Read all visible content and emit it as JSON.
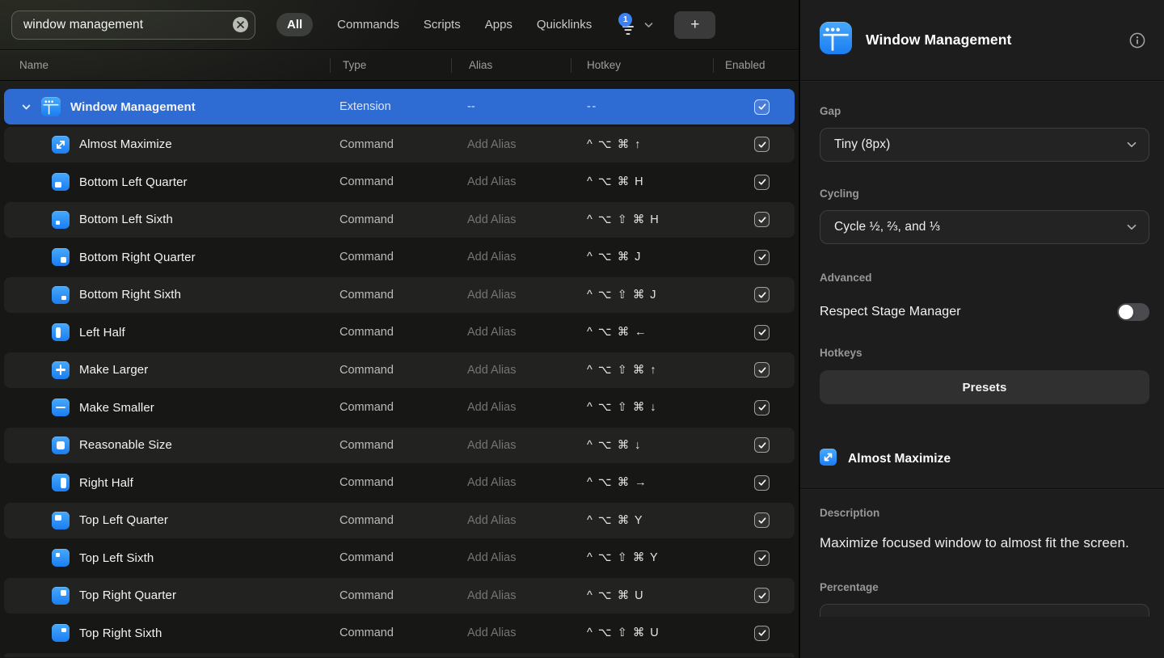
{
  "topbar": {
    "search_value": "window management",
    "tabs": [
      "All",
      "Commands",
      "Scripts",
      "Apps",
      "Quicklinks"
    ],
    "active_tab": "All",
    "filter_badge": "1",
    "add_label": "+"
  },
  "table": {
    "columns": [
      "Name",
      "Type",
      "Alias",
      "Hotkey",
      "Enabled"
    ],
    "rows": [
      {
        "name": "Window Management",
        "type": "Extension",
        "alias": "--",
        "hotkey": "--",
        "enabled": true,
        "icon": "window-management",
        "selected": true,
        "parent": true
      },
      {
        "name": "Almost Maximize",
        "type": "Command",
        "alias": "Add Alias",
        "hotkey": "^ ⌥ ⌘ ↑",
        "enabled": true,
        "icon": "almost-maximize"
      },
      {
        "name": "Bottom Left Quarter",
        "type": "Command",
        "alias": "Add Alias",
        "hotkey": "^ ⌥ ⌘ H",
        "enabled": true,
        "icon": "bottom-left-quarter"
      },
      {
        "name": "Bottom Left Sixth",
        "type": "Command",
        "alias": "Add Alias",
        "hotkey": "^ ⌥ ⇧ ⌘ H",
        "enabled": true,
        "icon": "bottom-left-sixth"
      },
      {
        "name": "Bottom Right Quarter",
        "type": "Command",
        "alias": "Add Alias",
        "hotkey": "^ ⌥ ⌘ J",
        "enabled": true,
        "icon": "bottom-right-quarter"
      },
      {
        "name": "Bottom Right Sixth",
        "type": "Command",
        "alias": "Add Alias",
        "hotkey": "^ ⌥ ⇧ ⌘ J",
        "enabled": true,
        "icon": "bottom-right-sixth"
      },
      {
        "name": "Left Half",
        "type": "Command",
        "alias": "Add Alias",
        "hotkey": "^ ⌥ ⌘ ←",
        "enabled": true,
        "icon": "left-half"
      },
      {
        "name": "Make Larger",
        "type": "Command",
        "alias": "Add Alias",
        "hotkey": "^ ⌥ ⇧ ⌘ ↑",
        "enabled": true,
        "icon": "make-larger"
      },
      {
        "name": "Make Smaller",
        "type": "Command",
        "alias": "Add Alias",
        "hotkey": "^ ⌥ ⇧ ⌘ ↓",
        "enabled": true,
        "icon": "make-smaller"
      },
      {
        "name": "Reasonable Size",
        "type": "Command",
        "alias": "Add Alias",
        "hotkey": "^ ⌥ ⌘ ↓",
        "enabled": true,
        "icon": "reasonable-size"
      },
      {
        "name": "Right Half",
        "type": "Command",
        "alias": "Add Alias",
        "hotkey": "^ ⌥ ⌘ →",
        "enabled": true,
        "icon": "right-half"
      },
      {
        "name": "Top Left Quarter",
        "type": "Command",
        "alias": "Add Alias",
        "hotkey": "^ ⌥ ⌘ Y",
        "enabled": true,
        "icon": "top-left-quarter"
      },
      {
        "name": "Top Left Sixth",
        "type": "Command",
        "alias": "Add Alias",
        "hotkey": "^ ⌥ ⇧ ⌘ Y",
        "enabled": true,
        "icon": "top-left-sixth"
      },
      {
        "name": "Top Right Quarter",
        "type": "Command",
        "alias": "Add Alias",
        "hotkey": "^ ⌥ ⌘ U",
        "enabled": true,
        "icon": "top-right-quarter"
      },
      {
        "name": "Top Right Sixth",
        "type": "Command",
        "alias": "Add Alias",
        "hotkey": "^ ⌥ ⇧ ⌘ U",
        "enabled": true,
        "icon": "top-right-sixth"
      }
    ]
  },
  "panel": {
    "title": "Window Management",
    "gap_label": "Gap",
    "gap_value": "Tiny (8px)",
    "cycling_label": "Cycling",
    "cycling_value": "Cycle ½, ⅔, and ⅓",
    "advanced_label": "Advanced",
    "stage_manager_label": "Respect Stage Manager",
    "stage_manager_enabled": false,
    "hotkeys_label": "Hotkeys",
    "presets_label": "Presets",
    "command_title": "Almost Maximize",
    "description_label": "Description",
    "description_text": "Maximize focused window to almost fit the screen.",
    "percentage_label": "Percentage"
  },
  "colors": {
    "selection_blue": "#2e6cd3",
    "icon_blue_top": "#47a9fa",
    "icon_blue_bottom": "#1b7df2",
    "badge_blue": "#3b82f6"
  }
}
